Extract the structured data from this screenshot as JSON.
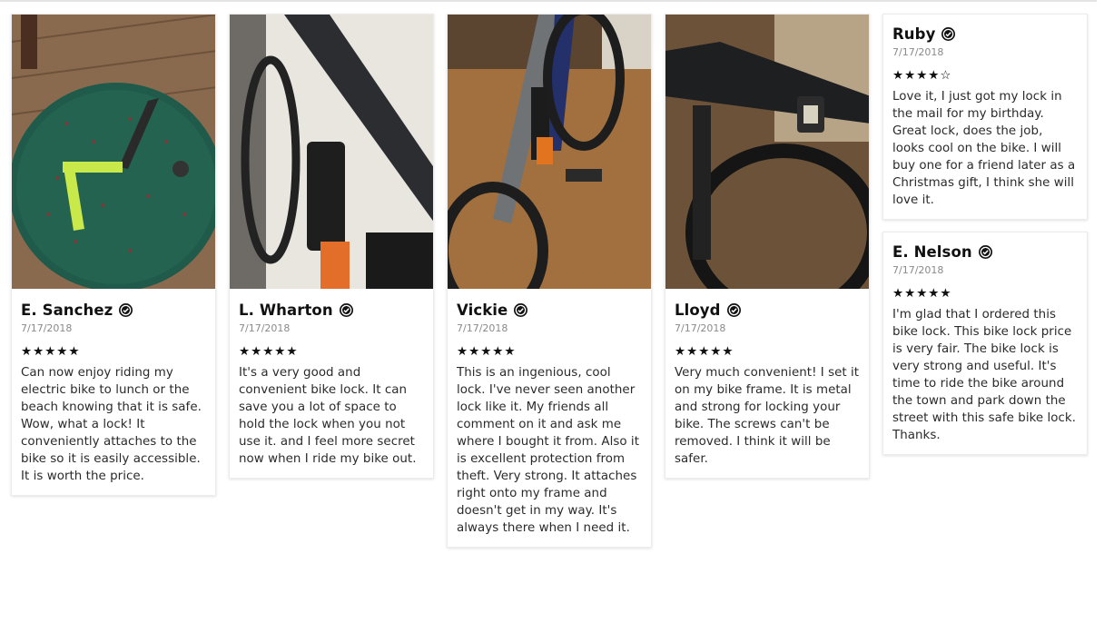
{
  "reviews": [
    {
      "name": "E. Sanchez",
      "date": "7/17/2018",
      "rating": 5,
      "stars": "★★★★★",
      "text": "Can now enjoy riding my electric bike to lunch or the beach knowing that it is safe. Wow, what a lock! It conveniently attaches to the bike so it is easily accessible. It is worth the price."
    },
    {
      "name": "L. Wharton",
      "date": "7/17/2018",
      "rating": 5,
      "stars": "★★★★★",
      "text": "It's a very good and convenient bike lock. It can save you a lot of space to hold the lock when you not use it. and I feel more secret now when I ride my bike out."
    },
    {
      "name": "Vickie",
      "date": "7/17/2018",
      "rating": 5,
      "stars": "★★★★★",
      "text": "This is an ingenious, cool lock. I've never seen another lock like it. My friends all comment on it and ask me where I bought it from. Also it is excellent protection from theft. Very strong. It attaches right onto my frame and doesn't get in my way. It's always there when I need it."
    },
    {
      "name": "Lloyd",
      "date": "7/17/2018",
      "rating": 5,
      "stars": "★★★★★",
      "text": "Very much convenient! I set it on my bike frame. It is metal and strong for locking your bike. The screws can't be removed. I think it will be safer."
    },
    {
      "name": "Ruby",
      "date": "7/17/2018",
      "rating": 4,
      "stars": "★★★★☆",
      "text": "Love it, I just got my lock in the mail for my birthday. Great lock, does the job, looks cool on the bike. I will buy one for a friend later as a Christmas gift, I think she will love it."
    },
    {
      "name": "E. Nelson",
      "date": "7/17/2018",
      "rating": 5,
      "stars": "★★★★★",
      "text": "I'm glad that I ordered this bike lock. This bike lock price is very fair. The bike lock is very strong and useful. It's time to ride the bike around the town and park down the street with this safe bike lock. Thanks."
    }
  ]
}
